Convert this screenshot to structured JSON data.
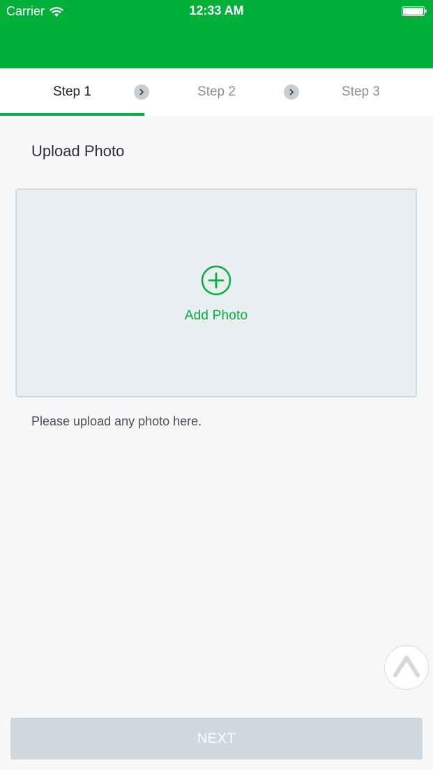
{
  "status_bar": {
    "carrier": "Carrier",
    "time": "12:33 AM",
    "icons": [
      "wifi-icon",
      "battery-icon"
    ]
  },
  "colors": {
    "brand_green": "#00b038",
    "background": "#f6f7f9",
    "upload_area": "#e9eef1",
    "disabled_button": "#cfd8de"
  },
  "steps": [
    {
      "label": "Step 1",
      "active": true
    },
    {
      "label": "Step 2",
      "active": false
    },
    {
      "label": "Step 3",
      "active": false
    }
  ],
  "content": {
    "title": "Upload Photo",
    "add_photo_label": "Add Photo",
    "help_text": "Please upload any photo here."
  },
  "footer": {
    "next_label": "NEXT"
  }
}
